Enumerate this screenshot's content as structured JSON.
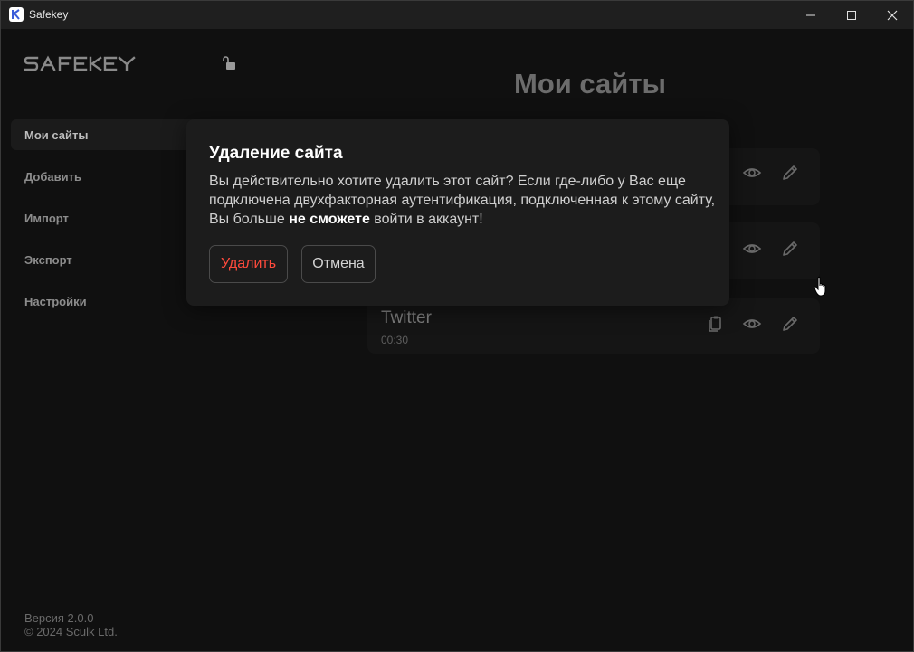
{
  "window": {
    "title": "Safekey",
    "controls": [
      "minimize-icon",
      "maximize-icon",
      "close-icon"
    ]
  },
  "sidebar": {
    "logo_text": "SAFEKEY",
    "lock_icon": "unlock-icon",
    "items": [
      {
        "label": "Мои сайты",
        "active": true
      },
      {
        "label": "Добавить",
        "active": false
      },
      {
        "label": "Импорт",
        "active": false
      },
      {
        "label": "Экспорт",
        "active": false
      },
      {
        "label": "Настройки",
        "active": false
      }
    ],
    "version": "Версия 2.0.0",
    "copyright": "© 2024 Sculk Ltd."
  },
  "main": {
    "title": "Мои сайты",
    "sites": [
      {
        "name": "Twitter",
        "code": "00:30",
        "icons": [
          "copy-icon",
          "eye-icon",
          "pencil-icon"
        ]
      }
    ]
  },
  "modal": {
    "title": "Удаление сайта",
    "text_before": "Вы действительно хотите удалить этот сайт? Если где-либо у Вас еще подключена двухфакторная аутентификация, подключенная к этому сайту, Вы больше ",
    "text_bold": "не сможете",
    "text_after": " войти в аккаунт!",
    "delete_label": "Удалить",
    "cancel_label": "Отмена"
  },
  "colors": {
    "background": "#101010",
    "danger": "#ff4a3c",
    "modal_bg": "#1c1c1c"
  }
}
